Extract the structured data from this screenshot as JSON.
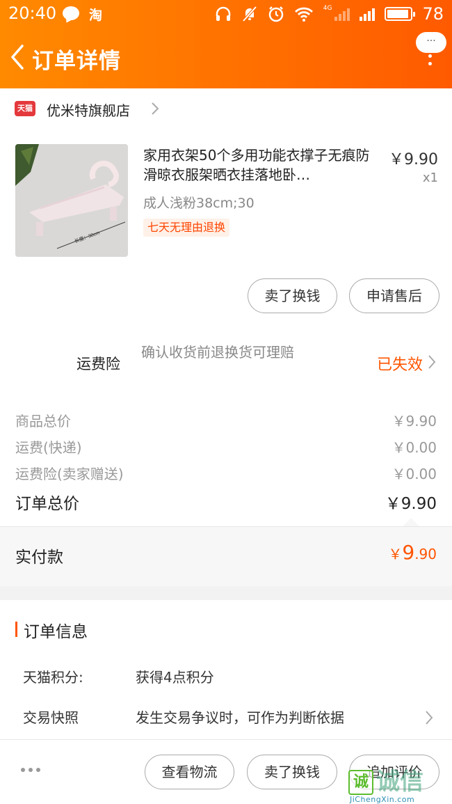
{
  "status_bar": {
    "time": "20:40",
    "app_badge": "淘",
    "network": "4G",
    "battery": "78"
  },
  "header": {
    "title": "订单详情",
    "more_bubble": "···"
  },
  "shop": {
    "badge": "天猫",
    "name": "优米特旗舰店"
  },
  "product": {
    "title": "家用衣架50个多用功能衣撑子无痕防滑晾衣服架晒衣挂落地卧…",
    "price": "￥9.90",
    "quantity": "x1",
    "spec": "成人浅粉38cm;30",
    "tag": "七天无理由退换",
    "thumb_caption": "长度：38cm",
    "buttons": [
      "卖了换钱",
      "申请售后"
    ]
  },
  "insurance": {
    "label": "运费险",
    "description": "确认收货前退换货可理赔",
    "status": "已失效"
  },
  "summary": {
    "rows": [
      {
        "label": "商品总价",
        "value": "￥9.90"
      },
      {
        "label": "运费(快递)",
        "value": "￥0.00"
      },
      {
        "label": "运费险(卖家赠送)",
        "value": "￥0.00"
      }
    ],
    "total_label": "订单总价",
    "total_value": "￥9.90"
  },
  "paid": {
    "label": "实付款",
    "currency": "￥",
    "integer": "9",
    "decimal": ".90"
  },
  "order_info": {
    "title": "订单信息",
    "rows": [
      {
        "label": "天猫积分:",
        "value": "获得4点积分"
      },
      {
        "label": "交易快照",
        "value": "发生交易争议时，可作为判断依据"
      }
    ]
  },
  "bottom_bar": {
    "buttons": [
      "查看物流",
      "卖了换钱",
      "追加评价"
    ]
  },
  "watermark": {
    "glyph": "诚",
    "text": "诚信",
    "url": "JiChengXin.com"
  },
  "colors": {
    "header_start": "#ff8a00",
    "header_end": "#ff5a00",
    "accent": "#ff5500"
  }
}
